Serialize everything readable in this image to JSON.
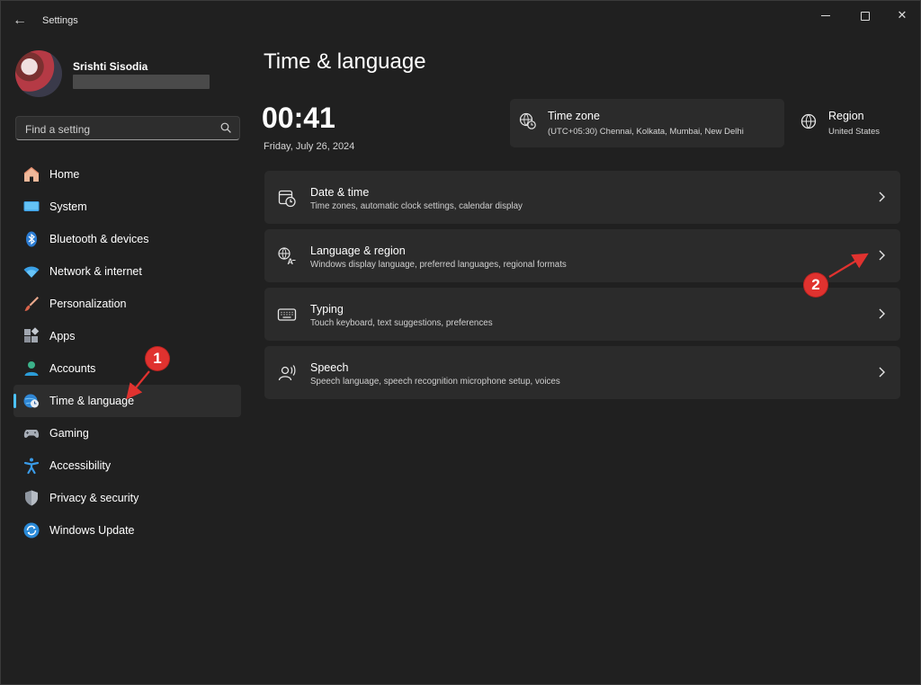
{
  "window": {
    "title": "Settings"
  },
  "profile": {
    "name": "Srishti Sisodia"
  },
  "search": {
    "placeholder": "Find a setting"
  },
  "sidebar": {
    "items": [
      {
        "label": "Home",
        "icon": "home-icon"
      },
      {
        "label": "System",
        "icon": "monitor-icon"
      },
      {
        "label": "Bluetooth & devices",
        "icon": "bluetooth-icon"
      },
      {
        "label": "Network & internet",
        "icon": "wifi-icon"
      },
      {
        "label": "Personalization",
        "icon": "brush-icon"
      },
      {
        "label": "Apps",
        "icon": "apps-grid-icon"
      },
      {
        "label": "Accounts",
        "icon": "person-icon"
      },
      {
        "label": "Time & language",
        "icon": "globe-clock-icon",
        "selected": true
      },
      {
        "label": "Gaming",
        "icon": "gamepad-icon"
      },
      {
        "label": "Accessibility",
        "icon": "accessibility-icon"
      },
      {
        "label": "Privacy & security",
        "icon": "shield-icon"
      },
      {
        "label": "Windows Update",
        "icon": "update-icon"
      }
    ]
  },
  "main": {
    "title": "Time & language",
    "clock": {
      "time": "00:41",
      "date": "Friday, July 26, 2024"
    },
    "timezone": {
      "title": "Time zone",
      "value": "(UTC+05:30) Chennai, Kolkata, Mumbai, New Delhi"
    },
    "region": {
      "title": "Region",
      "value": "United States"
    },
    "cards": [
      {
        "title": "Date & time",
        "subtitle": "Time zones, automatic clock settings, calendar display",
        "icon": "calendar-clock-icon"
      },
      {
        "title": "Language & region",
        "subtitle": "Windows display language, preferred languages, regional formats",
        "icon": "language-icon"
      },
      {
        "title": "Typing",
        "subtitle": "Touch keyboard, text suggestions, preferences",
        "icon": "keyboard-icon"
      },
      {
        "title": "Speech",
        "subtitle": "Speech language, speech recognition microphone setup, voices",
        "icon": "speech-icon"
      }
    ]
  },
  "annotations": [
    {
      "label": "1"
    },
    {
      "label": "2"
    }
  ],
  "colors": {
    "accent": "#4cc2ff",
    "annotation": "#e0322f",
    "background": "#202020",
    "card": "#2b2b2b"
  }
}
